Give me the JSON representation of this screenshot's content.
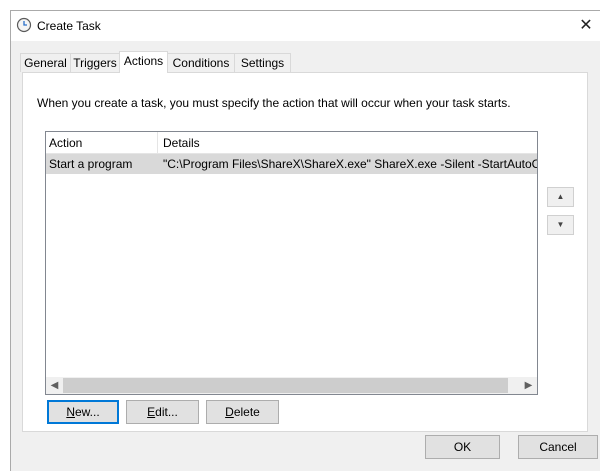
{
  "window": {
    "title": "Create Task",
    "close_glyph": "✕"
  },
  "tabs": [
    {
      "label": "General"
    },
    {
      "label": "Triggers"
    },
    {
      "label": "Actions"
    },
    {
      "label": "Conditions"
    },
    {
      "label": "Settings"
    }
  ],
  "active_tab": "Actions",
  "actions": {
    "description": "When you create a task, you must specify the action that will occur when your task starts.",
    "columns": [
      "Action",
      "Details"
    ],
    "rows": [
      {
        "action": "Start a program",
        "details": "\"C:\\Program Files\\ShareX\\ShareX.exe\" ShareX.exe -Silent -StartAutoCapture"
      }
    ],
    "move_up_icon": "triangle-up-icon",
    "move_down_icon": "triangle-down-icon",
    "buttons": {
      "new": {
        "mnemonic": "N",
        "rest": "ew..."
      },
      "edit": {
        "mnemonic": "E",
        "rest": "dit..."
      },
      "delete": {
        "mnemonic": "D",
        "rest": "elete"
      }
    }
  },
  "footer": {
    "ok_label": "OK",
    "cancel_label": "Cancel"
  },
  "colors": {
    "selected_row": "#d9d9d9",
    "default_button_border": "#0078d7"
  }
}
